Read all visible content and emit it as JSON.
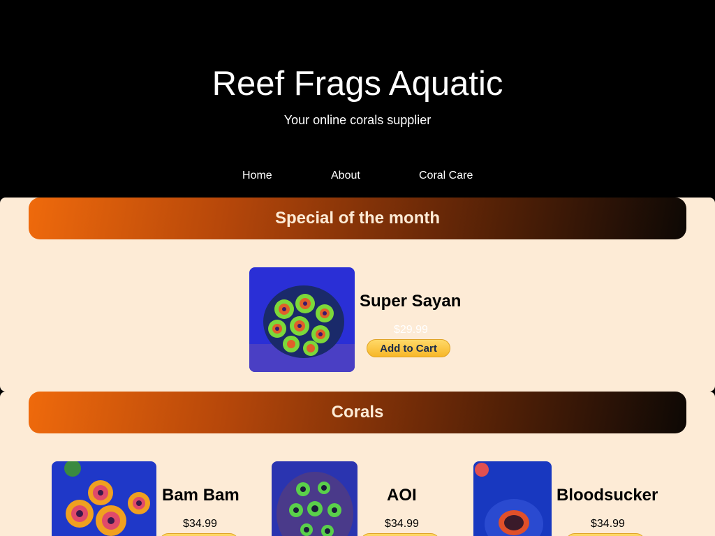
{
  "header": {
    "title": "Reef Frags Aquatic",
    "tagline": "Your online corals supplier"
  },
  "nav": {
    "home": "Home",
    "about": "About",
    "coral_care": "Coral Care"
  },
  "special": {
    "heading": "Special of the month",
    "product": {
      "name": "Super Sayan",
      "price": "$29.99",
      "button_label": "Add to Cart",
      "image_icon": "coral-photo-super-sayan"
    }
  },
  "corals": {
    "heading": "Corals",
    "products": [
      {
        "name": "Bam Bam",
        "price": "$34.99",
        "image_icon": "coral-photo-bam-bam"
      },
      {
        "name": "AOI",
        "price": "$34.99",
        "image_icon": "coral-photo-aoi"
      },
      {
        "name": "Bloodsucker",
        "price": "$34.99",
        "image_icon": "coral-photo-bloodsucker"
      }
    ]
  },
  "colors": {
    "header_bg": "#000000",
    "section_bg": "#fdebd6",
    "banner_start": "#ef6a0c",
    "banner_end": "#0d0805",
    "button": "#f7b728"
  }
}
